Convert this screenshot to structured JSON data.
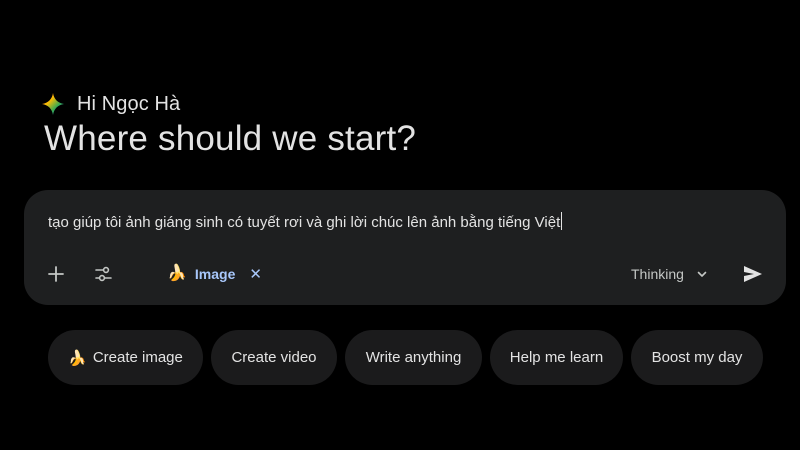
{
  "greeting": {
    "text": "Hi Ngọc Hà",
    "icon": "gemini-sparkle-icon"
  },
  "headline": "Where should we start?",
  "composer": {
    "prompt_value": "tạo giúp tôi ảnh giáng sinh có tuyết rơi và ghi lời chúc lên ảnh bằng tiếng Việt",
    "add_icon": "plus-icon",
    "tools_icon": "sliders-icon",
    "active_tool": {
      "icon": "banana-emoji",
      "emoji": "🍌",
      "label": "Image",
      "remove_glyph": "✕"
    },
    "mode_label": "Thinking",
    "mode_icon": "chevron-down-icon",
    "send_icon": "send-icon"
  },
  "suggestions": [
    {
      "emoji": "🍌",
      "label": "Create image"
    },
    {
      "emoji": "",
      "label": "Create video"
    },
    {
      "emoji": "",
      "label": "Write anything"
    },
    {
      "emoji": "",
      "label": "Help me learn"
    },
    {
      "emoji": "",
      "label": "Boost my day"
    }
  ],
  "colors": {
    "background": "#000000",
    "surface": "#1e1f20",
    "chip_surface": "#1b1b1c",
    "text": "#e3e3e3",
    "accent": "#a8c7fa"
  }
}
